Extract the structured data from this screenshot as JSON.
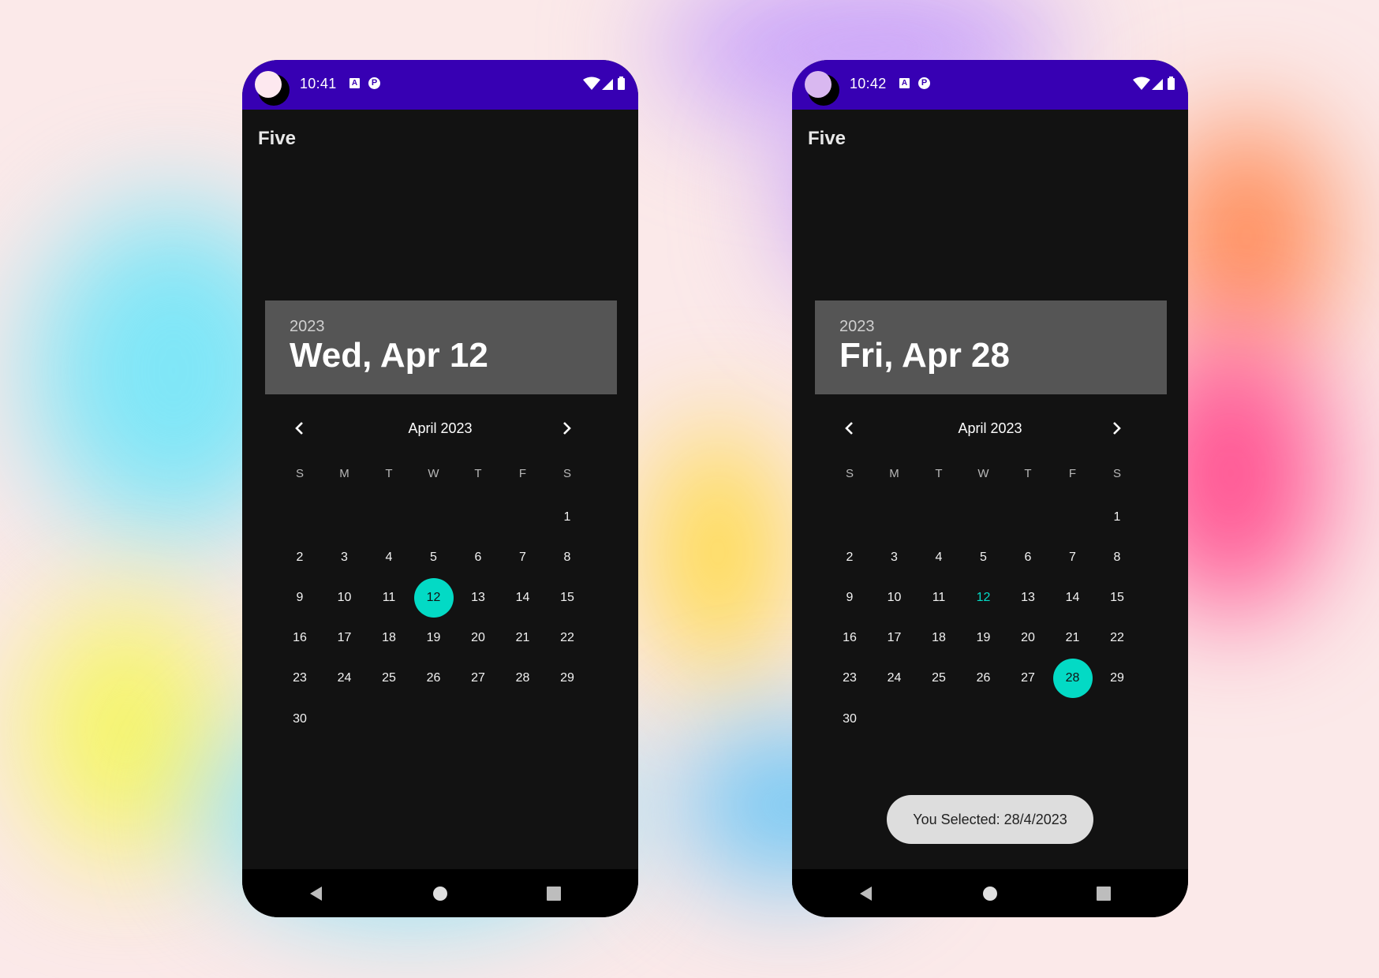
{
  "colors": {
    "status_bar": "#3700b3",
    "screen_bg": "#121212",
    "header_bg": "#555555",
    "selected_day": "#03dac5",
    "today_text": "#03dac5",
    "toast_bg": "#dddddd"
  },
  "calendar": {
    "weekdays": [
      "S",
      "M",
      "T",
      "W",
      "T",
      "F",
      "S"
    ],
    "first_weekday_index": 6,
    "days_in_month": 30
  },
  "phones": [
    {
      "status_time": "10:41",
      "camera_color": "#fde8ef",
      "app_title": "Five",
      "header_year": "2023",
      "header_date": "Wed, Apr 12",
      "month_label": "April 2023",
      "selected_day": 12,
      "today_day": 12,
      "toast": null
    },
    {
      "status_time": "10:42",
      "camera_color": "#d9b8f0",
      "app_title": "Five",
      "header_year": "2023",
      "header_date": "Fri, Apr 28",
      "month_label": "April 2023",
      "selected_day": 28,
      "today_day": 12,
      "toast": "You Selected: 28/4/2023"
    }
  ],
  "icons": {
    "prev_month": "chevron-left-icon",
    "next_month": "chevron-right-icon",
    "status_a": "a-notification-icon",
    "status_p": "p-notification-icon",
    "wifi": "wifi-icon",
    "signal": "signal-icon",
    "battery": "battery-icon",
    "nav_back": "back-triangle-icon",
    "nav_home": "home-circle-icon",
    "nav_recent": "recents-square-icon"
  }
}
